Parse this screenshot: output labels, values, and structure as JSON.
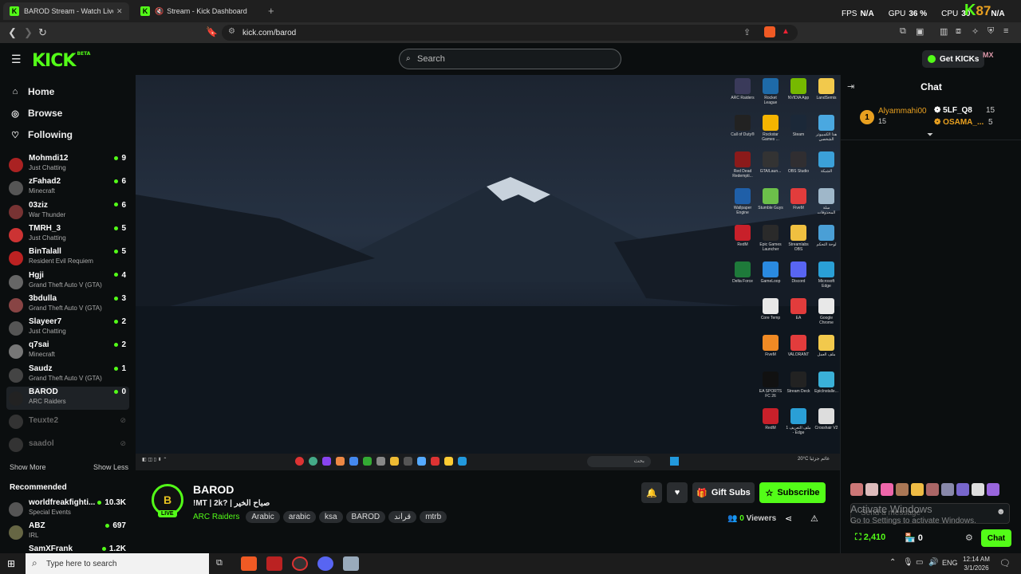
{
  "browser": {
    "tabs": [
      {
        "title": "BAROD Stream - Watch Live on"
      },
      {
        "title": "Stream - Kick Dashboard"
      }
    ],
    "url": "kick.com/barod",
    "overlay": {
      "fps": "FPS",
      "fps_val": "N/A",
      "gpu": "GPU",
      "gpu_val": "36 %",
      "cpu": "CPU",
      "cpu_val": "30",
      "na2": "N/A",
      "k": "K",
      "k_num": "87"
    }
  },
  "header": {
    "logo": "KICK",
    "logo_tag": "BETA",
    "search_placeholder": "Search",
    "get_kicks": "Get KICKs",
    "avatar_label": "MX"
  },
  "sidebar": {
    "nav": [
      {
        "label": "Home",
        "icon": "home-icon"
      },
      {
        "label": "Browse",
        "icon": "compass-icon"
      },
      {
        "label": "Following",
        "icon": "heart-icon"
      }
    ],
    "following": [
      {
        "name": "Mohmdi12",
        "game": "Just Chatting",
        "viewers": "9"
      },
      {
        "name": "zFahad2",
        "game": "Minecraft",
        "viewers": "6"
      },
      {
        "name": "03ziz",
        "game": "War Thunder",
        "viewers": "6"
      },
      {
        "name": "TMRH_3",
        "game": "Just Chatting",
        "viewers": "5"
      },
      {
        "name": "BinTalall",
        "game": "Resident Evil Requiem",
        "viewers": "5"
      },
      {
        "name": "Hgji",
        "game": "Grand Theft Auto V (GTA)",
        "viewers": "4"
      },
      {
        "name": "3bdulla",
        "game": "Grand Theft Auto V (GTA)",
        "viewers": "3"
      },
      {
        "name": "Slayeer7",
        "game": "Just Chatting",
        "viewers": "2"
      },
      {
        "name": "q7sai",
        "game": "Minecraft",
        "viewers": "2"
      },
      {
        "name": "Saudz",
        "game": "Grand Theft Auto V (GTA)",
        "viewers": "1"
      },
      {
        "name": "BAROD",
        "game": "ARC Raiders",
        "viewers": "0"
      }
    ],
    "offline": [
      {
        "name": "Teuxte2"
      },
      {
        "name": "saadol"
      }
    ],
    "show_more": "Show More",
    "show_less": "Show Less",
    "recommended_title": "Recommended",
    "recommended": [
      {
        "name": "worldfreakfighti...",
        "game": "Special Events",
        "viewers": "10.3K"
      },
      {
        "name": "ABZ",
        "game": "IRL",
        "viewers": "697"
      },
      {
        "name": "SamXFrank",
        "game": "",
        "viewers": "1.2K"
      }
    ]
  },
  "desktop": {
    "icons": [
      {
        "label": "ARC Raiders",
        "color": "#3a3a5a"
      },
      {
        "label": "Rocket League",
        "color": "#1e6aa8"
      },
      {
        "label": "NVIDIA App",
        "color": "#76b900"
      },
      {
        "label": "LandSemis",
        "color": "#f2c94c"
      },
      {
        "label": "Call of Duty®",
        "color": "#222"
      },
      {
        "label": "Rockstar Games ...",
        "color": "#f5b400"
      },
      {
        "label": "Steam",
        "color": "#1b2838"
      },
      {
        "label": "هذا الكمبيوتر الشخصي",
        "color": "#4aa8e0"
      },
      {
        "label": "Red Dead Redempti...",
        "color": "#8b1a1a"
      },
      {
        "label": "GTA/Laun...",
        "color": "#333"
      },
      {
        "label": "OBS Studio",
        "color": "#302e31"
      },
      {
        "label": "الشبكة",
        "color": "#3ba0d8"
      },
      {
        "label": "Wallpaper Engine",
        "color": "#1f5fa8"
      },
      {
        "label": "Stumble Guys",
        "color": "#6cc04a"
      },
      {
        "label": "FiveM",
        "color": "#e23c3c"
      },
      {
        "label": "سلة المحذوفات",
        "color": "#9fb7c9"
      },
      {
        "label": "RedM",
        "color": "#c8202a"
      },
      {
        "label": "Epic Games Launcher",
        "color": "#2a2a2a"
      },
      {
        "label": "Streamlabs OBS",
        "color": "#f0c040"
      },
      {
        "label": "لوحة التحكم",
        "color": "#4a9fd6"
      },
      {
        "label": "Delta Force",
        "color": "#1e7a3a"
      },
      {
        "label": "GameLoop",
        "color": "#2a8ae0"
      },
      {
        "label": "Discord",
        "color": "#5865f2"
      },
      {
        "label": "Microsoft Edge",
        "color": "#2a9fd6"
      },
      {
        "label": "Core Temp",
        "color": "#e8e8e8"
      },
      {
        "label": "EA",
        "color": "#e23c3c"
      },
      {
        "label": "Google Chrome",
        "color": "#e8e8e8"
      },
      {
        "label": "FiveM",
        "color": "#f08a24"
      },
      {
        "label": "VALORANT",
        "color": "#e23c3c"
      },
      {
        "label": "ملف العمل",
        "color": "#f2c94c"
      },
      {
        "label": "EA SPORTS FC 26",
        "color": "#111"
      },
      {
        "label": "Stream Deck",
        "color": "#222"
      },
      {
        "label": "EpicInstalle...",
        "color": "#3ab0d8"
      },
      {
        "label": "RedM",
        "color": "#c8202a"
      },
      {
        "label": "ملف التعريف 1 - Edge",
        "color": "#2a9fd6"
      },
      {
        "label": "Crosshair V2",
        "color": "#ddd"
      }
    ],
    "tray_weather": "20°C غائم جزئيا",
    "tray_search": "بحث"
  },
  "stream": {
    "channel": "BAROD",
    "title": "!MT | 2k? | صباح الخير",
    "category": "ARC Raiders",
    "tags": [
      "Arabic",
      "arabic",
      "ksa",
      "BAROD",
      "قراند",
      "mtrb"
    ],
    "live": "LIVE",
    "viewers": "0",
    "viewers_label": "Viewers",
    "gift_subs": "Gift Subs",
    "subscribe": "Subscribe",
    "followers": "2,410",
    "shop_count": "0"
  },
  "chat": {
    "title": "Chat",
    "leaderboard": [
      {
        "rank": "1",
        "name": "Alyammahi00",
        "count": "15"
      },
      {
        "name": "5LF_Q8",
        "count": "15"
      },
      {
        "name": "OSAMA_...",
        "count": "5"
      }
    ],
    "input_placeholder": "Send a message",
    "send_label": "Chat",
    "activate_title": "Activate Windows",
    "activate_sub": "Go to Settings to activate Windows."
  },
  "taskbar": {
    "search_placeholder": "Type here to search",
    "time": "12:14 AM",
    "date": "3/1/2026",
    "lang": "ENG"
  },
  "colors": {
    "accent": "#53fc18",
    "bg": "#0b0e0f"
  }
}
